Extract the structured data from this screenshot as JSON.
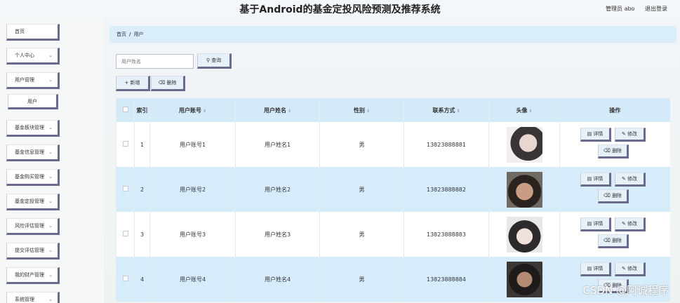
{
  "header": {
    "title": "基于Android的基金定投风险预测及推荐系统",
    "role": "管理员",
    "username": "abo",
    "logout": "退出登录"
  },
  "sidebar": {
    "items": [
      {
        "label": "首页",
        "chevron": ""
      },
      {
        "label": "个人中心",
        "chevron": "⌄"
      },
      {
        "label": "用户管理",
        "chevron": "⌄"
      },
      {
        "label": "用户",
        "chevron": ""
      },
      {
        "label": "基金板块管理",
        "chevron": "⌄"
      },
      {
        "label": "基金信息管理",
        "chevron": "⌄"
      },
      {
        "label": "基金购买管理",
        "chevron": "⌄"
      },
      {
        "label": "基金定投管理",
        "chevron": "⌄"
      },
      {
        "label": "风险评估管理",
        "chevron": "⌄"
      },
      {
        "label": "提交评估管理",
        "chevron": "⌄"
      },
      {
        "label": "我的财产管理",
        "chevron": "⌄"
      },
      {
        "label": "系统管理",
        "chevron": "⌄"
      }
    ]
  },
  "breadcrumb": {
    "home": "首页",
    "sep": "/",
    "current": "用户"
  },
  "search": {
    "placeholder": "用户姓名",
    "button": "查询"
  },
  "toolbar": {
    "add": "新增",
    "delete": "删除"
  },
  "table": {
    "headers": {
      "index": "索引",
      "account": "用户账号",
      "name": "用户姓名",
      "gender": "性别",
      "phone": "联系方式",
      "avatar": "头像",
      "ops": "操作"
    },
    "rows": [
      {
        "index": "1",
        "account": "用户账号1",
        "name": "用户姓名1",
        "gender": "男",
        "phone": "13823888881"
      },
      {
        "index": "2",
        "account": "用户账号2",
        "name": "用户姓名2",
        "gender": "男",
        "phone": "13823888882"
      },
      {
        "index": "3",
        "account": "用户账号3",
        "name": "用户姓名3",
        "gender": "男",
        "phone": "13823888883"
      },
      {
        "index": "4",
        "account": "用户账号4",
        "name": "用户姓名4",
        "gender": "男",
        "phone": "13823888884"
      }
    ],
    "ops": {
      "detail": "详情",
      "edit": "修改",
      "delete": "删除"
    }
  },
  "watermark": "CSDN @阿诚程序",
  "icons": {
    "search": "search-icon",
    "add": "plus-icon",
    "delete": "trash-icon",
    "detail": "doc-icon",
    "edit": "pencil-icon",
    "sort": "sort-icon"
  },
  "colors": {
    "accent": "#6a6a8e",
    "header_row": "#d5eaf8",
    "stripe": "#d7ecfb",
    "breadcrumb": "#d9edfa"
  }
}
